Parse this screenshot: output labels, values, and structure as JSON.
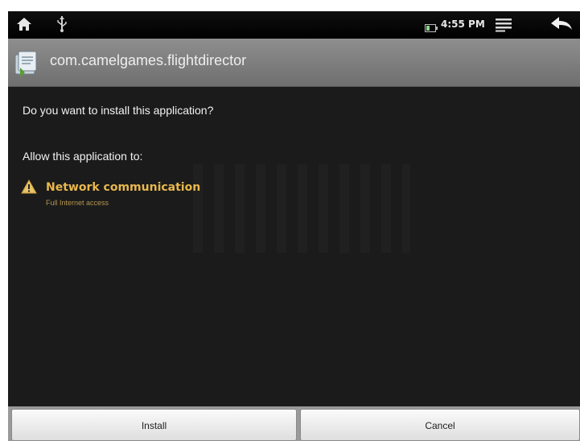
{
  "status_bar": {
    "time": "4:55 PM",
    "icons": [
      "home-icon",
      "usb-icon",
      "battery-icon",
      "menu-icon",
      "back-arrow-icon"
    ]
  },
  "title_bar": {
    "package_name": "com.camelgames.flightdirector",
    "icon": "package-installer-icon"
  },
  "content": {
    "question": "Do you want to install this application?",
    "allow_heading": "Allow this application to:",
    "permissions": [
      {
        "title": "Network communication",
        "description": "Full Internet access",
        "icon": "warning-icon"
      }
    ]
  },
  "buttons": {
    "install_label": "Install",
    "cancel_label": "Cancel"
  },
  "colors": {
    "screen_bg": "#1b1b1b",
    "title_bar_bg": "#7f7f7f",
    "permission_title": "#e8b84c",
    "permission_desc": "#b59552",
    "text": "#f2f2f2"
  }
}
